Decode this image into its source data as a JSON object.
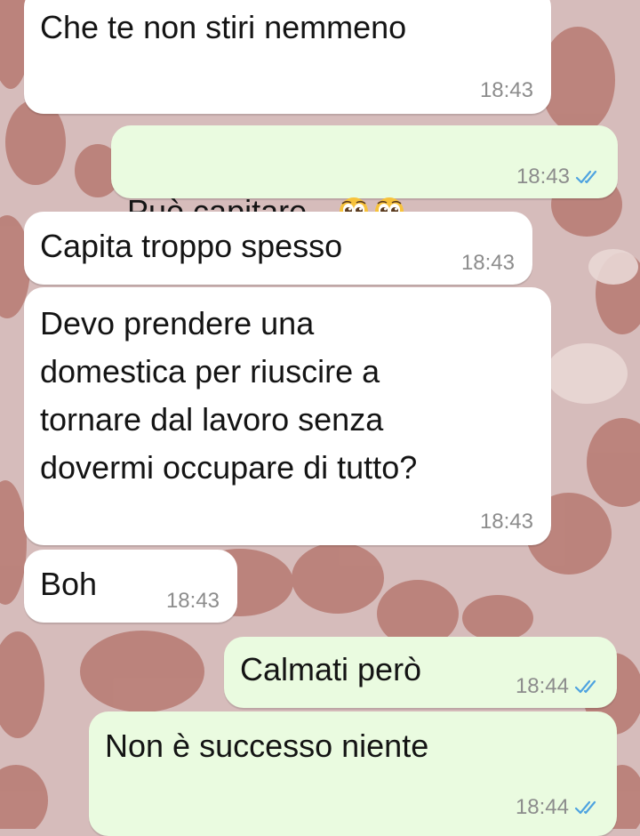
{
  "colors": {
    "wallpaper": "#d6bcbb",
    "incoming_bubble": "#ffffff",
    "outgoing_bubble": "#eafbe0",
    "read_ticks": "#4fa3e0",
    "timestamp": "#8c8c8c"
  },
  "messages": [
    {
      "direction": "incoming",
      "text": "Che te non stiri nemmeno",
      "time": "18:43"
    },
    {
      "direction": "outgoing",
      "text": "Può capitare...",
      "emojis": [
        "pleading-face-icon",
        "pleading-face-icon"
      ],
      "time": "18:43",
      "status": "read"
    },
    {
      "direction": "incoming",
      "text": "Capita troppo spesso",
      "time": "18:43"
    },
    {
      "direction": "incoming",
      "text": "Devo prendere una\ndomestica per riuscire a\ntornare dal lavoro senza\ndovermi occupare di tutto?",
      "time": "18:43"
    },
    {
      "direction": "incoming",
      "text": "Boh",
      "time": "18:43"
    },
    {
      "direction": "outgoing",
      "text": "Calmati però",
      "time": "18:44",
      "status": "read"
    },
    {
      "direction": "outgoing",
      "text": "Non è successo niente",
      "time": "18:44",
      "status": "read"
    }
  ]
}
